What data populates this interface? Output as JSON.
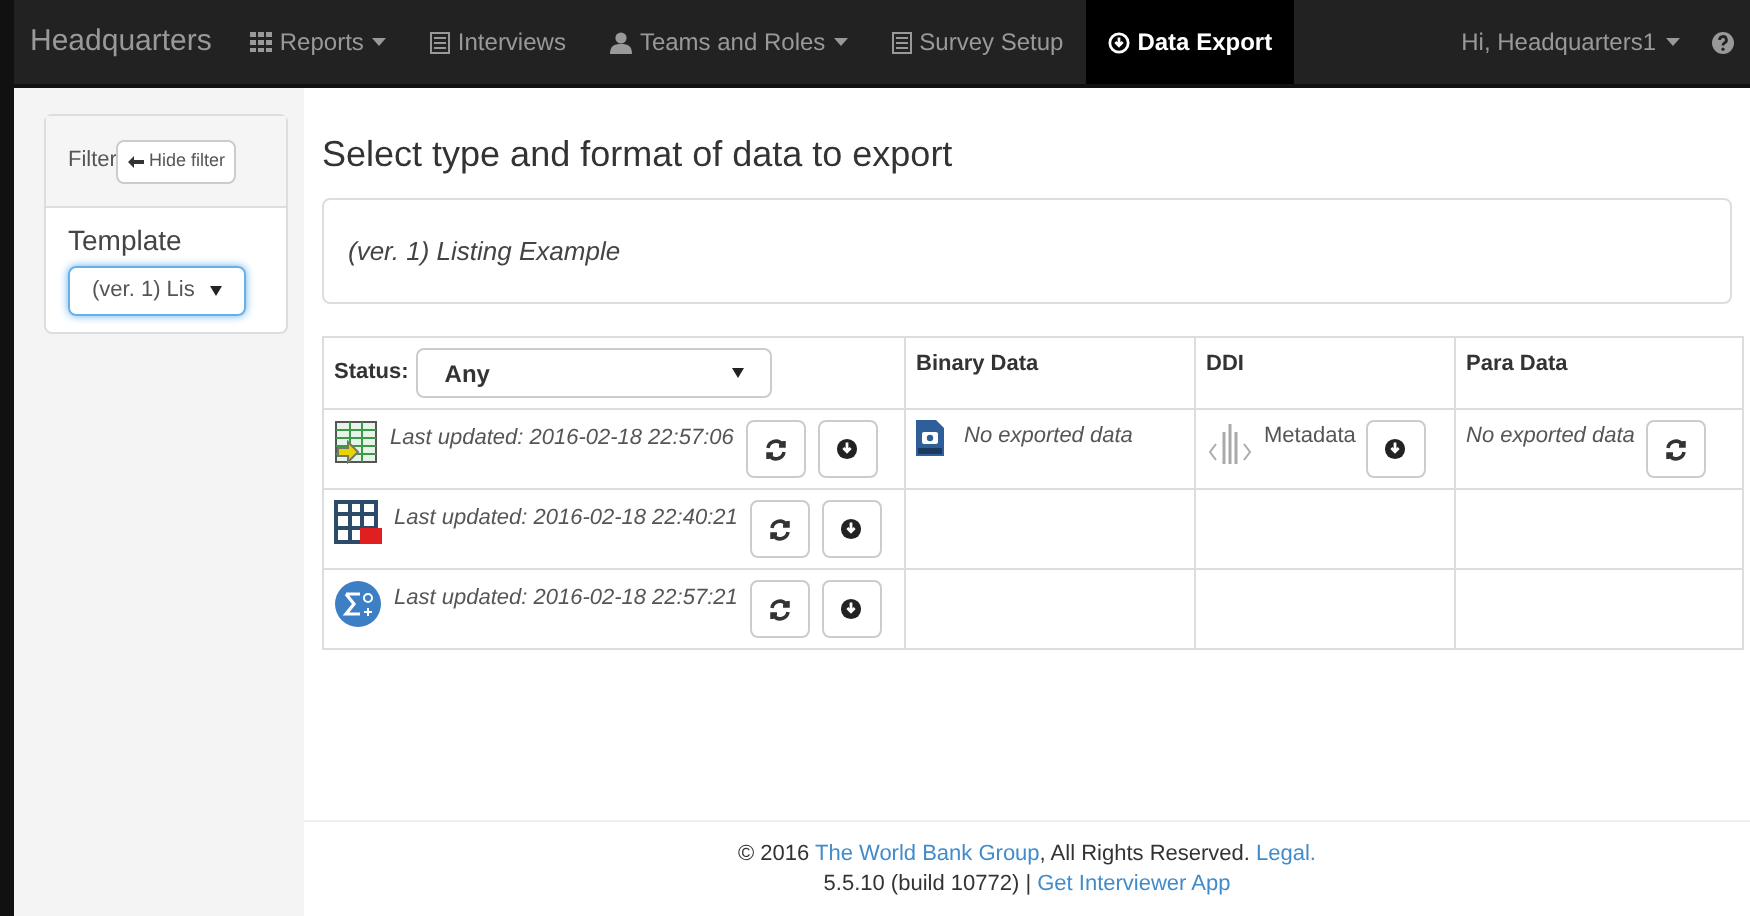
{
  "navbar": {
    "brand": "Headquarters",
    "items": [
      {
        "label": "Reports",
        "dropdown": true,
        "selected": false
      },
      {
        "label": "Interviews",
        "dropdown": false,
        "selected": false
      },
      {
        "label": "Teams and Roles",
        "dropdown": true,
        "selected": false
      },
      {
        "label": "Survey Setup",
        "dropdown": false,
        "selected": false
      },
      {
        "label": "Data Export",
        "dropdown": false,
        "selected": true
      }
    ],
    "user": "Hi, Headquarters1"
  },
  "sidebar": {
    "filter_label": "Filter",
    "hide_button": "Hide filter",
    "template_label": "Template",
    "template_value": "(ver. 1) Lis"
  },
  "heading": "Select type and format of data to export",
  "questionnaire": "(ver. 1) Listing Example",
  "table": {
    "status_label": "Status:",
    "status_value": "Any",
    "columns": [
      "Binary Data",
      "DDI",
      "Para Data"
    ],
    "rows": [
      {
        "kind": "tab",
        "updated": "Last updated: 2016-02-18 22:57:06",
        "binary": "No exported data",
        "ddi": "Metadata",
        "para": "No exported data"
      },
      {
        "kind": "spss",
        "updated": "Last updated: 2016-02-18 22:40:21"
      },
      {
        "kind": "stata",
        "updated": "Last updated: 2016-02-18 22:57:21"
      }
    ]
  },
  "footer": {
    "line1": [
      {
        "text": "© 2016 ",
        "link": false
      },
      {
        "text": "The World Bank Group",
        "link": true
      },
      {
        "text": ", All Rights Reserved. ",
        "link": false
      },
      {
        "text": "Legal.",
        "link": true
      }
    ],
    "line2": [
      {
        "text": "5.5.10 (build 10772) | ",
        "link": false
      },
      {
        "text": "Get Interviewer App",
        "link": true
      }
    ]
  }
}
